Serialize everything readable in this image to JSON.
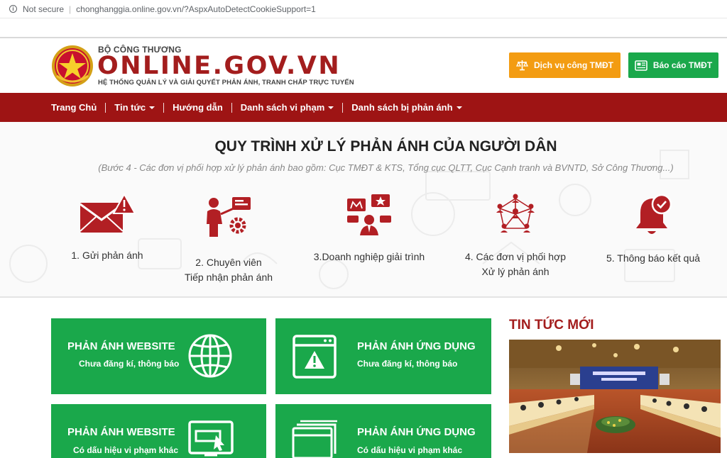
{
  "browser": {
    "security_label": "Not secure",
    "url": "chonghanggia.online.gov.vn/?AspxAutoDetectCookieSupport=1"
  },
  "header": {
    "ministry": "BỘ CÔNG THƯƠNG",
    "site_name": "ONLINE.GOV.VN",
    "tagline": "HỆ THỐNG QUẢN LÝ VÀ GIẢI QUYẾT PHẢN ÁNH, TRANH CHẤP TRỰC TUYẾN",
    "buttons": {
      "public_service": "Dịch vụ công TMĐT",
      "report": "Báo cáo TMĐT"
    }
  },
  "nav": {
    "items": [
      {
        "label": "Trang Chủ",
        "dropdown": false
      },
      {
        "label": "Tin tức",
        "dropdown": true
      },
      {
        "label": "Hướng dẫn",
        "dropdown": false
      },
      {
        "label": "Danh sách vi phạm",
        "dropdown": true
      },
      {
        "label": "Danh sách bị phản ánh",
        "dropdown": true
      }
    ]
  },
  "process": {
    "title": "QUY TRÌNH XỬ LÝ PHẢN ÁNH CỦA NGƯỜI DÂN",
    "subtitle": "(Bước 4 - Các đơn vị phối hợp xử lý phản ánh bao gồm: Cục TMĐT & KTS, Tổng cục QLTT, Cục Cạnh tranh và BVNTD, Sở Công Thương...)",
    "steps": [
      {
        "line1": "1. Gửi phản ánh",
        "line2": "",
        "icon": "envelope-warning-icon"
      },
      {
        "line1": "2. Chuyên viên",
        "line2": "Tiếp nhận phản ánh",
        "icon": "specialist-gear-icon"
      },
      {
        "line1": "3.Doanh nghiệp giải trình",
        "line2": "",
        "icon": "business-explain-icon"
      },
      {
        "line1": "4. Các đơn vị phối hợp",
        "line2": "Xử lý phản ánh",
        "icon": "network-people-icon"
      },
      {
        "line1": "5. Thông báo kết quả",
        "line2": "",
        "icon": "bell-check-icon"
      }
    ]
  },
  "cards": [
    {
      "title": "PHẢN ÁNH WEBSITE",
      "subtitle": "Chưa đăng kí, thông báo",
      "icon": "globe-icon"
    },
    {
      "title": "PHẢN ÁNH ỨNG DỤNG",
      "subtitle": "Chưa đăng kí, thông báo",
      "icon": "app-warning-icon"
    },
    {
      "title": "PHẢN ÁNH WEBSITE",
      "subtitle": "Có dấu hiệu vi phạm khác",
      "icon": "browser-cursor-icon"
    },
    {
      "title": "PHẢN ÁNH ỨNG DỤNG",
      "subtitle": "Có dấu hiệu vi phạm khác",
      "icon": "app-windows-icon"
    }
  ],
  "news": {
    "title": "TIN TỨC MỚI"
  },
  "colors": {
    "brand_red": "#9e1414",
    "title_red": "#a31d1d",
    "green": "#1aa84b",
    "orange": "#f39c12"
  }
}
